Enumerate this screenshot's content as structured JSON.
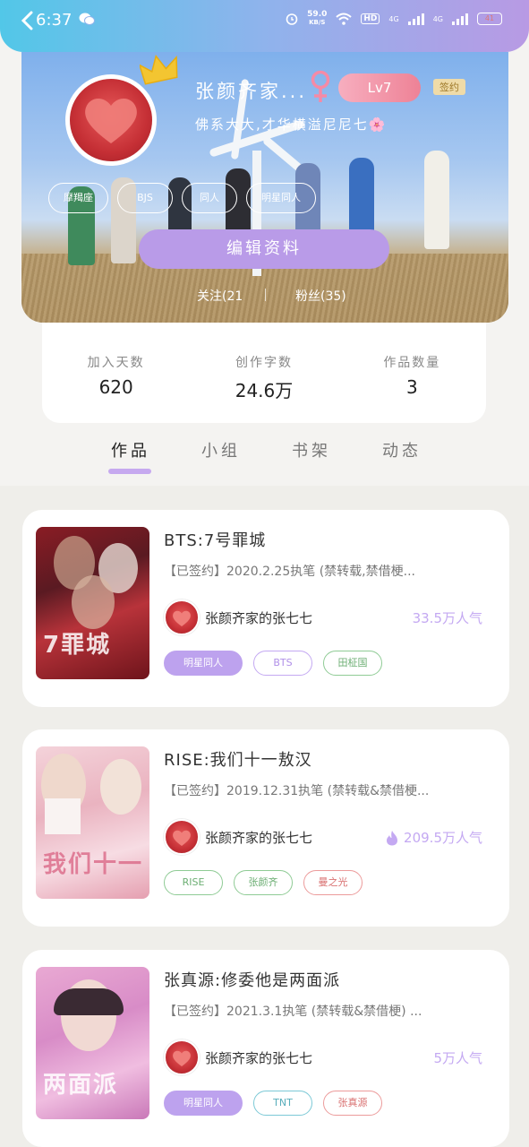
{
  "status_bar": {
    "time": "6:37",
    "net_speed": "59.0",
    "net_unit": "KB/S",
    "hd": "HD",
    "signal1": "4G",
    "signal2": "4G",
    "battery": "41"
  },
  "profile": {
    "username": "张颜齐家...",
    "level": "Lv7",
    "signed_badge": "签约",
    "motto": "佛系大大,才华横溢尼尼七🌸",
    "tags": [
      "摩羯座",
      "BJS",
      "同人",
      "明星同人"
    ],
    "edit_button": "编辑资料",
    "following": "关注(21",
    "fans": "粉丝(35)"
  },
  "stats": [
    {
      "label": "加入天数",
      "value": "620"
    },
    {
      "label": "创作字数",
      "value": "24.6万"
    },
    {
      "label": "作品数量",
      "value": "3"
    }
  ],
  "tabs": [
    "作品",
    "小组",
    "书架",
    "动态"
  ],
  "works": [
    {
      "title": "BTS:7号罪城",
      "desc": "【已签约】2020.2.25执笔 (禁转载,禁借梗...",
      "author": "张颜齐家的张七七",
      "popularity": "33.5万人气",
      "hot": false,
      "cover_text": "7罪城",
      "tags": [
        {
          "label": "明星同人",
          "style": "filled"
        },
        {
          "label": "BTS",
          "style": "purple"
        },
        {
          "label": "田柾国",
          "style": "green"
        }
      ]
    },
    {
      "title": "RISE:我们十一敖汉",
      "desc": "【已签约】2019.12.31执笔 (禁转载&禁借梗...",
      "author": "张颜齐家的张七七",
      "popularity": "209.5万人气",
      "hot": true,
      "cover_text": "我们十一",
      "tags": [
        {
          "label": "RISE",
          "style": "green"
        },
        {
          "label": "张颜齐",
          "style": "green"
        },
        {
          "label": "曼之光",
          "style": "red"
        }
      ]
    },
    {
      "title": "张真源:修委他是两面派",
      "desc": "【已签约】2021.3.1执笔 (禁转载&禁借梗) ...",
      "author": "张颜齐家的张七七",
      "popularity": "5万人气",
      "hot": false,
      "cover_text": "两面派",
      "tags": [
        {
          "label": "明星同人",
          "style": "filled"
        },
        {
          "label": "TNT",
          "style": "teal"
        },
        {
          "label": "张真源",
          "style": "red"
        }
      ]
    }
  ]
}
